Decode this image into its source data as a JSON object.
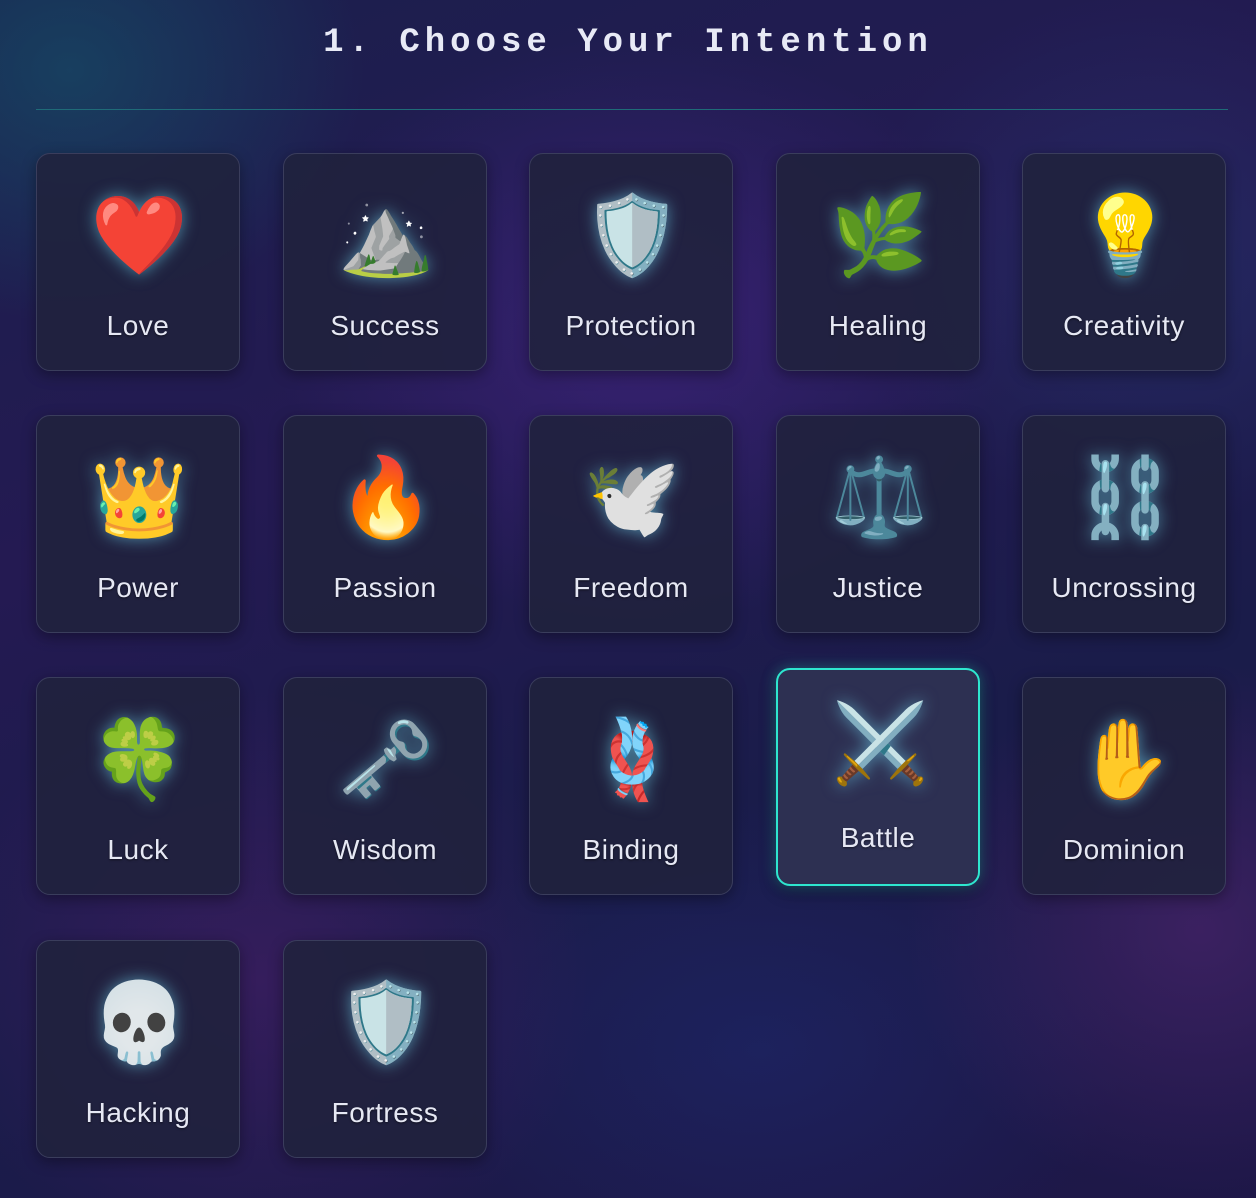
{
  "header": {
    "title": "1. Choose Your Intention"
  },
  "intentions": [
    {
      "label": "Love",
      "icon": "heart-icon",
      "glyph": "❤️"
    },
    {
      "label": "Success",
      "icon": "mountain-star-icon",
      "glyph": "⛰️"
    },
    {
      "label": "Protection",
      "icon": "shield-icon",
      "glyph": "🛡️"
    },
    {
      "label": "Healing",
      "icon": "healing-leaf-icon",
      "glyph": "🌿"
    },
    {
      "label": "Creativity",
      "icon": "lightbulb-icon",
      "glyph": "💡"
    },
    {
      "label": "Power",
      "icon": "crown-icon",
      "glyph": "👑"
    },
    {
      "label": "Passion",
      "icon": "flame-icon",
      "glyph": "🔥"
    },
    {
      "label": "Freedom",
      "icon": "phoenix-bird-icon",
      "glyph": "🕊️"
    },
    {
      "label": "Justice",
      "icon": "scales-icon",
      "glyph": "⚖️"
    },
    {
      "label": "Uncrossing",
      "icon": "broken-chain-icon",
      "glyph": "⛓️"
    },
    {
      "label": "Luck",
      "icon": "four-leaf-clover-icon",
      "glyph": "🍀"
    },
    {
      "label": "Wisdom",
      "icon": "eye-key-icon",
      "glyph": "🗝️"
    },
    {
      "label": "Binding",
      "icon": "rope-knot-icon",
      "glyph": "🪢"
    },
    {
      "label": "Battle",
      "icon": "swords-shield-icon",
      "glyph": "⚔️"
    },
    {
      "label": "Dominion",
      "icon": "radiant-hand-icon",
      "glyph": "✋"
    },
    {
      "label": "Hacking",
      "icon": "skull-icon",
      "glyph": "💀"
    },
    {
      "label": "Fortress",
      "icon": "hex-shield-icon",
      "glyph": "🛡️"
    }
  ],
  "selected": "Battle",
  "colors": {
    "accent": "#2ee6cf",
    "tile_bg": "#20223c",
    "tile_border": "#3a3d5c",
    "divider": "#1f6b78"
  }
}
